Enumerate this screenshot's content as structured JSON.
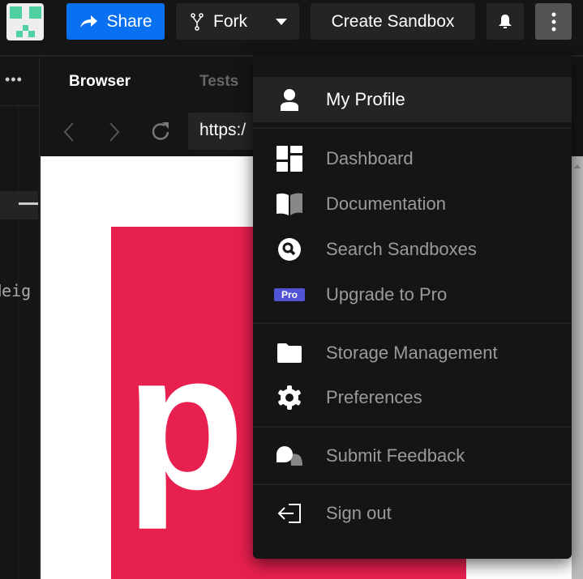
{
  "header": {
    "share_label": "Share",
    "fork_label": "Fork",
    "create_label": "Create Sandbox"
  },
  "colors": {
    "share": "#0971f1",
    "preview_brand": "#e8204f",
    "pro_badge": "#5054d4"
  },
  "panel": {
    "tabs": [
      "Browser",
      "Tests"
    ],
    "url": "https:/",
    "editor_snippet": "Heig"
  },
  "preview": {
    "letter": "p"
  },
  "menu": {
    "items": [
      {
        "label": "My Profile",
        "icon": "user-icon"
      },
      {
        "label": "Dashboard",
        "icon": "dashboard-icon"
      },
      {
        "label": "Documentation",
        "icon": "book-icon"
      },
      {
        "label": "Search Sandboxes",
        "icon": "search-icon"
      },
      {
        "label": "Upgrade to Pro",
        "icon": "pro-badge-icon"
      },
      {
        "label": "Storage Management",
        "icon": "folder-icon"
      },
      {
        "label": "Preferences",
        "icon": "gear-icon"
      },
      {
        "label": "Submit Feedback",
        "icon": "chat-bubbles-icon"
      },
      {
        "label": "Sign out",
        "icon": "sign-out-icon"
      }
    ],
    "pro_badge": "Pro"
  }
}
